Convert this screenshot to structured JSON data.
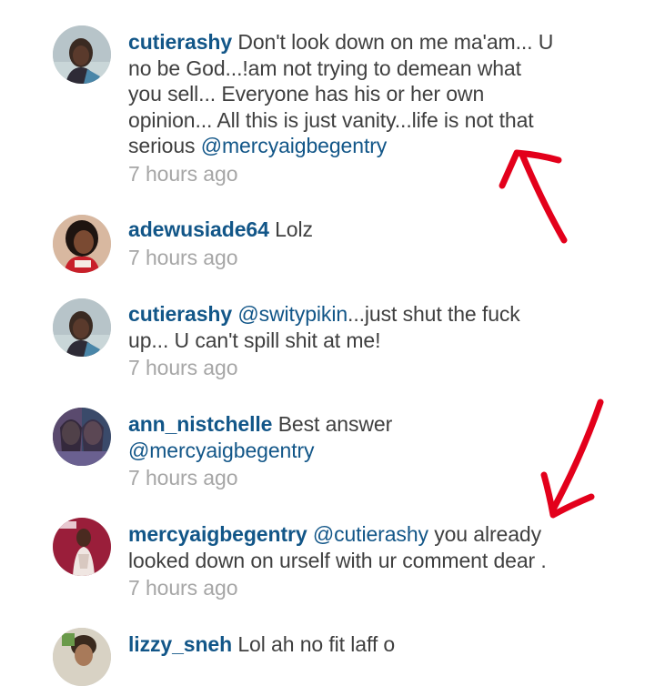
{
  "comments": [
    {
      "username": "cutierashy",
      "text_lines": [
        "Don't look down on me ma'am... U",
        "no be God...!am not trying to demean what",
        "you sell... Everyone has his or her own",
        "opinion... All this is just vanity...life is not that",
        "serious "
      ],
      "mention_end": "@mercyaigbegentry",
      "timestamp": "7 hours ago",
      "avatar_icon": "profile-photo-icon"
    },
    {
      "username": "adewusiade64",
      "text": "Lolz",
      "timestamp": "7 hours ago",
      "avatar_icon": "profile-photo-icon"
    },
    {
      "username": "cutierashy",
      "mention_start": "@switypikin",
      "text": "...just shut the fuck",
      "text_line2": "up... U can't spill shit at me!",
      "timestamp": "7 hours ago",
      "avatar_icon": "profile-photo-icon"
    },
    {
      "username": "ann_nistchelle",
      "text": "Best answer",
      "mention_line2": "@mercyaigbegentry",
      "timestamp": "7 hours ago",
      "avatar_icon": "profile-photo-icon"
    },
    {
      "username": "mercyaigbegentry",
      "mention_start": "@cutierashy",
      "text": "you already",
      "text_line2": "looked down on urself with ur comment dear .",
      "timestamp": "7 hours ago",
      "avatar_icon": "profile-photo-icon"
    },
    {
      "username": "lizzy_sneh",
      "text": "Lol ah no fit laff o",
      "avatar_icon": "profile-photo-icon"
    }
  ],
  "annotation_color": "#e3001b"
}
